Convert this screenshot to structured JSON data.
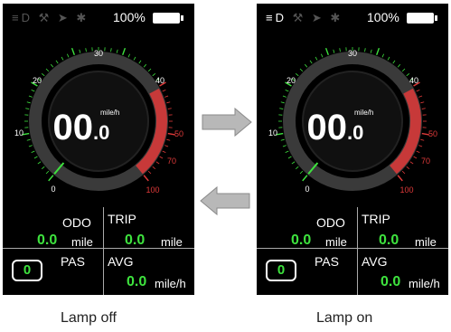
{
  "left_screen": {
    "battery_percent": "100%",
    "speed_main": "00",
    "speed_decimal": ".0",
    "speed_unit": "mile/h",
    "dial_ticks": [
      "0",
      "10",
      "20",
      "30",
      "40",
      "50",
      "70",
      "100"
    ],
    "odo_label": "ODO",
    "trip_label": "TRIP",
    "odo_value": "0.0",
    "odo_unit": "mile",
    "trip_value": "0.0",
    "trip_unit": "mile",
    "pas_label": "PAS",
    "pas_value": "0",
    "avg_label": "AVG",
    "avg_value": "0.0",
    "avg_unit": "mile/h",
    "lamp_on": false
  },
  "right_screen": {
    "battery_percent": "100%",
    "speed_main": "00",
    "speed_decimal": ".0",
    "speed_unit": "mile/h",
    "dial_ticks": [
      "0",
      "10",
      "20",
      "30",
      "40",
      "50",
      "70",
      "100"
    ],
    "odo_label": "ODO",
    "trip_label": "TRIP",
    "odo_value": "0.0",
    "odo_unit": "mile",
    "trip_value": "0.0",
    "trip_unit": "mile",
    "pas_label": "PAS",
    "pas_value": "0",
    "avg_label": "AVG",
    "avg_value": "0.0",
    "avg_unit": "mile/h",
    "lamp_on": true
  },
  "captions": {
    "left": "Lamp off",
    "right": "Lamp on"
  },
  "colors": {
    "green": "#3ee33e",
    "red": "#e03a3a",
    "icon_dim": "#555555",
    "icon_lit": "#ffffff"
  }
}
